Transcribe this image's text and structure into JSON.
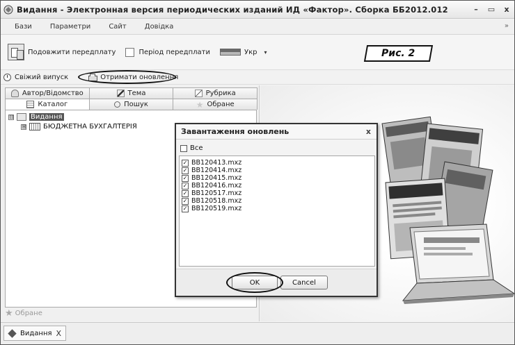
{
  "window": {
    "title": "Видання - Электронная версия периодических изданий ИД «Фактор». Сборка ББ2012.012",
    "controls": [
      "–",
      "▭",
      "x"
    ]
  },
  "menu": {
    "items": [
      "Бази",
      "Параметри",
      "Сайт",
      "Довідка"
    ],
    "collapse_glyph": "»"
  },
  "toolbar": {
    "extend_subscription_label": "Подовжити передплату",
    "subscription_period_label": "Період передплати",
    "language_label": "Укр",
    "dropdown_glyph": "▾"
  },
  "figure_label": "Рис. 2",
  "actions": {
    "fresh_issue_label": "Свіжий випуск",
    "get_updates_label": "Отримати оновлення"
  },
  "left_panel": {
    "tabs_row1": [
      "Автор/Відомство",
      "Тема",
      "Рубрика"
    ],
    "tabs_row2": [
      "Каталог",
      "Пошук",
      "Обране"
    ],
    "tree": {
      "root_label": "Видання",
      "root_expander": "⊟",
      "child_label": "БЮДЖЕТНА БУХГАЛТЕРІЯ",
      "child_expander": "⊞"
    },
    "favorites_label": "Обране"
  },
  "bottom_tab": {
    "label": "Видання",
    "close_glyph": "X"
  },
  "dialog": {
    "title": "Завантаження оновлень",
    "close_glyph": "x",
    "select_all_label": "Все",
    "select_all_checked": false,
    "files": [
      {
        "name": "BB120413.mxz",
        "checked": true
      },
      {
        "name": "BB120414.mxz",
        "checked": true
      },
      {
        "name": "BB120415.mxz",
        "checked": true
      },
      {
        "name": "BB120416.mxz",
        "checked": true
      },
      {
        "name": "BB120517.mxz",
        "checked": true
      },
      {
        "name": "BB120518.mxz",
        "checked": true
      },
      {
        "name": "BB120519.mxz",
        "checked": true
      }
    ],
    "check_glyph": "✓",
    "ok_label": "OK",
    "cancel_label": "Cancel"
  },
  "colors": {
    "accent_dark": "#111111",
    "selection": "#555555"
  }
}
